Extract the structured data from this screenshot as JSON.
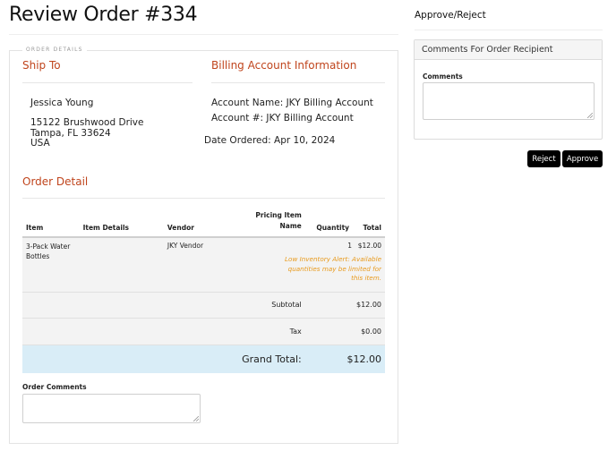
{
  "page": {
    "title": "Review Order #334",
    "legend": "ORDER DETAILS"
  },
  "ship_to": {
    "heading": "Ship To",
    "name": "Jessica Young",
    "address_lines": [
      "15122 Brushwood Drive",
      "Tampa, FL 33624",
      "USA"
    ]
  },
  "billing": {
    "heading": "Billing Account Information",
    "account_name": "Account Name: JKY Billing Account",
    "account_number": "Account #: JKY Billing Account",
    "date_ordered": "Date Ordered: Apr 10, 2024"
  },
  "order_detail": {
    "heading": "Order Detail",
    "columns": {
      "item": "Item",
      "item_details": "Item Details",
      "vendor": "Vendor",
      "pricing_item_name": "Pricing Item Name",
      "quantity": "Quantity",
      "total": "Total"
    },
    "rows": [
      {
        "item": "3-Pack Water Bottles",
        "item_details": "",
        "vendor": "JKY Vendor",
        "pricing_item_name": "",
        "quantity": "1",
        "total": "$12.00",
        "alert": "Low Inventory Alert: Available quantities may be limited for this item."
      }
    ],
    "subtotal_label": "Subtotal",
    "subtotal_value": "$12.00",
    "tax_label": "Tax",
    "tax_value": "$0.00",
    "grand_total_label": "Grand Total:",
    "grand_total_value": "$12.00"
  },
  "order_comments": {
    "label": "Order Comments",
    "value": ""
  },
  "approve_reject": {
    "heading": "Approve/Reject",
    "panel_title": "Comments For Order Recipient",
    "comments_label": "Comments",
    "comments_value": "",
    "reject_label": "Reject",
    "approve_label": "Approve"
  },
  "colors": {
    "heading_accent": "#c0451d",
    "alert": "#e89a1c",
    "grand_total_bg": "#d9edf7",
    "button_bg": "#000000"
  }
}
